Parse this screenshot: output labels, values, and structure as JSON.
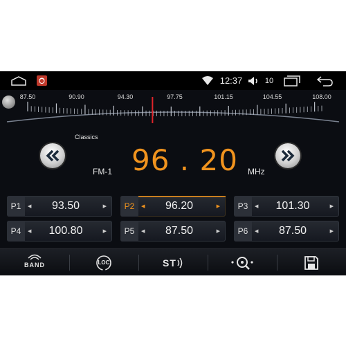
{
  "statusbar": {
    "time": "12:37",
    "volume_level": "10",
    "icons": [
      "home-icon",
      "app-icon",
      "wifi-icon",
      "volume-icon",
      "recent-apps-icon",
      "back-icon"
    ]
  },
  "scale": {
    "labels": [
      "87.50",
      "90.90",
      "94.30",
      "97.75",
      "101.15",
      "104.55",
      "108.00"
    ],
    "range": [
      87.5,
      108.0
    ],
    "needle_value": 96.2,
    "needle_color": "#e0242a"
  },
  "radio": {
    "station_name": "Classics",
    "band": "FM-1",
    "frequency": "96 . 20",
    "unit": "MHz",
    "accent_color": "#f0931e"
  },
  "presets": [
    {
      "id": "P1",
      "freq": "93.50",
      "active": false
    },
    {
      "id": "P2",
      "freq": "96.20",
      "active": true
    },
    {
      "id": "P3",
      "freq": "101.30",
      "active": false
    },
    {
      "id": "P4",
      "freq": "100.80",
      "active": false
    },
    {
      "id": "P5",
      "freq": "87.50",
      "active": false
    },
    {
      "id": "P6",
      "freq": "87.50",
      "active": false
    }
  ],
  "toolbar": {
    "band_label": "BAND",
    "loc_label": "LOC",
    "st_label": "ST",
    "icons": [
      "band-icon",
      "loc-icon",
      "stereo-icon",
      "scan-icon",
      "save-icon"
    ]
  }
}
